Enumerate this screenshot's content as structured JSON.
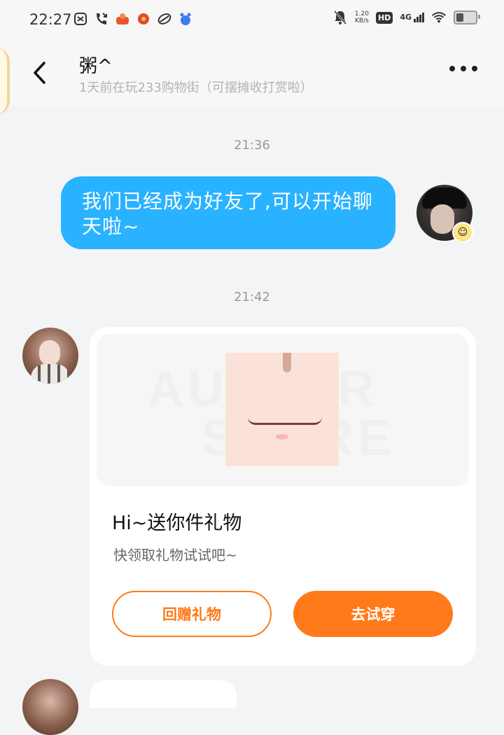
{
  "status_bar": {
    "time": "22:27",
    "net_speed_value": "1.20",
    "net_speed_unit": "KB/s",
    "hd_badge": "HD",
    "network_type": "4G",
    "app_icons": [
      "notification-app-icon",
      "missed-call-icon",
      "app-icon-orange",
      "app-icon-red",
      "app-icon-link",
      "app-icon-blue"
    ]
  },
  "header": {
    "contact_name": "粥^",
    "contact_status": "1天前在玩233购物街（可摆摊收打赏啦）"
  },
  "messages": {
    "time_1": "21:36",
    "outgoing_text": "我们已经成为好友了,可以开始聊天啦~",
    "time_2": "21:42"
  },
  "gift_card": {
    "watermark_line1": "AUSTAR",
    "watermark_line2": "STORE",
    "title": "Hi~送你件礼物",
    "subtitle": "快领取礼物试试吧~",
    "return_gift_label": "回赠礼物",
    "try_on_label": "去试穿"
  },
  "colors": {
    "outgoing_bubble": "#29b2ff",
    "accent_orange": "#ff7a1a"
  }
}
